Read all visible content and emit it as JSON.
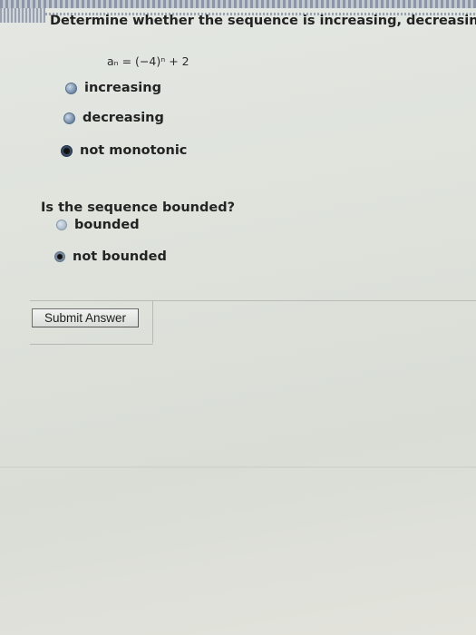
{
  "question": {
    "prompt": "Determine whether the sequence is increasing, decreasing,",
    "formula": "aₙ = (−4)ⁿ + 2"
  },
  "monotonic_options": [
    {
      "label": "increasing",
      "selected": false
    },
    {
      "label": "decreasing",
      "selected": false
    },
    {
      "label": "not monotonic",
      "selected": true
    }
  ],
  "bounded_question": {
    "prompt": "Is the sequence bounded?",
    "options": [
      {
        "label": "bounded",
        "selected": false
      },
      {
        "label": "not bounded",
        "selected": true
      }
    ]
  },
  "actions": {
    "submit_label": "Submit Answer"
  }
}
